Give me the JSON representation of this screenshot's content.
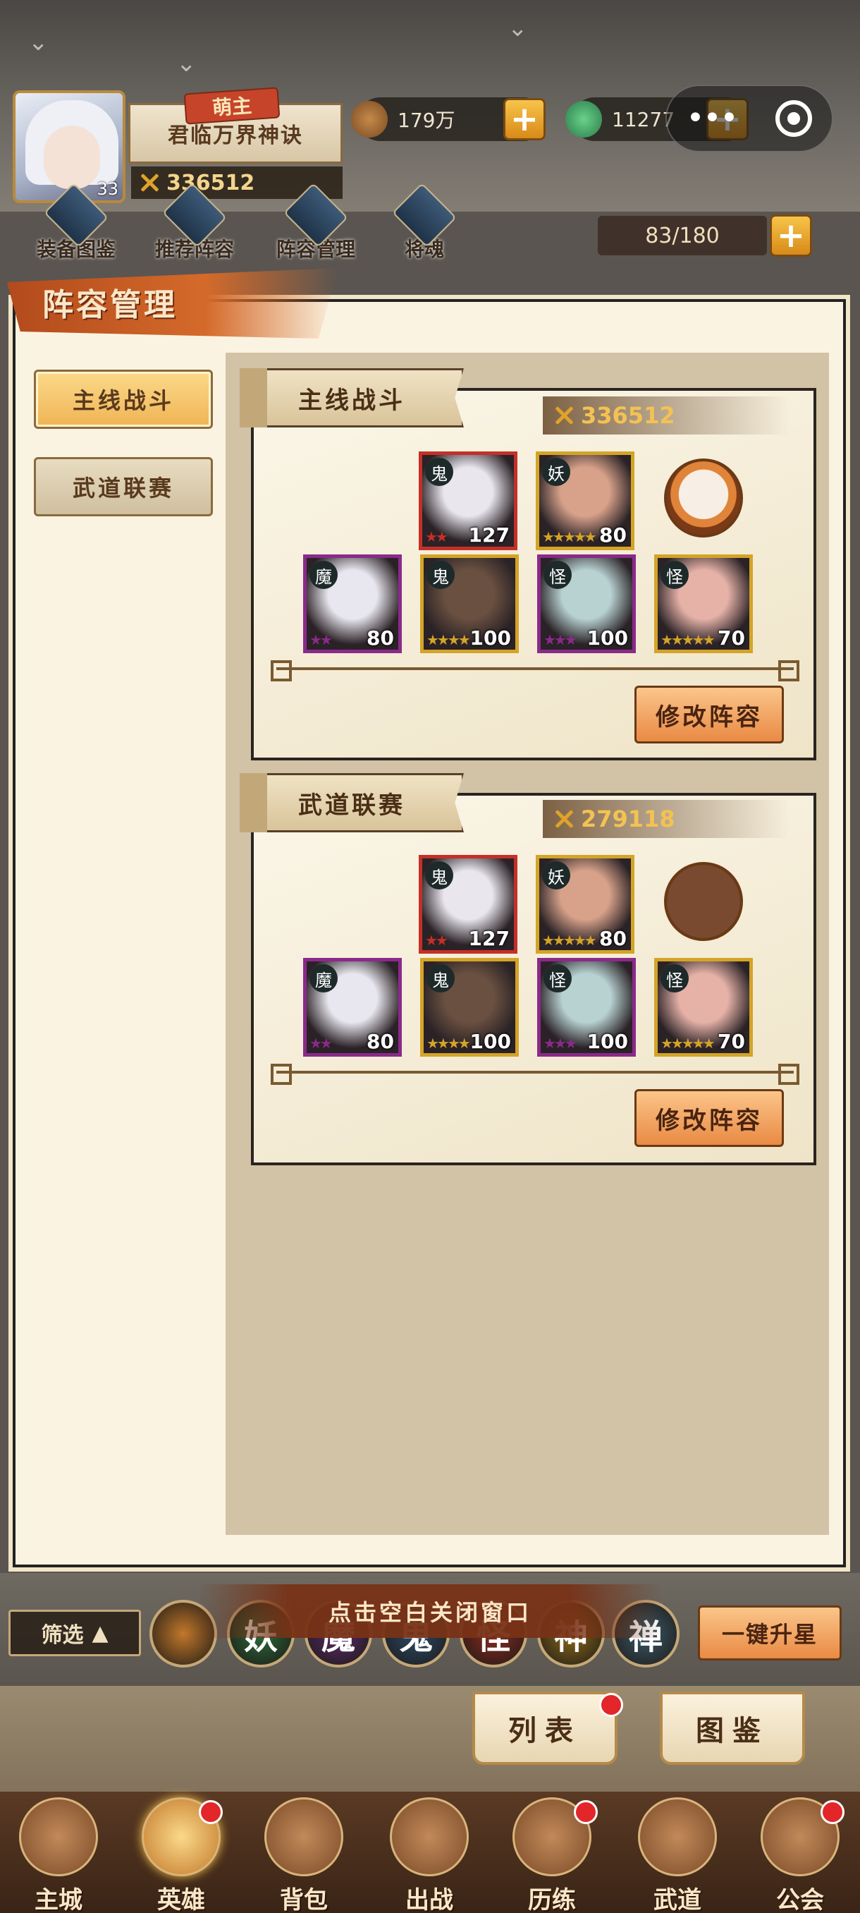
{
  "player": {
    "level": "33",
    "rank_badge": "萌主",
    "name": "君临万界神诀",
    "power": "336512"
  },
  "currencies": [
    {
      "name": "copper-coin",
      "value": "179万"
    },
    {
      "name": "jade",
      "value": "11277"
    }
  ],
  "shortcuts": [
    "装备图鉴",
    "推荐阵容",
    "阵容管理",
    "将魂"
  ],
  "hero_capacity": "83/180",
  "dialog": {
    "title": "阵容管理",
    "side_tabs": [
      {
        "label": "主线战斗",
        "active": true
      },
      {
        "label": "武道联赛",
        "active": false
      }
    ],
    "lineups": [
      {
        "label": "主线战斗",
        "power": "336512",
        "edit_label": "修改阵容",
        "pet_empty": false,
        "heroes": [
          {
            "faction": "鬼",
            "stars": "★★",
            "level": "127",
            "frame": "#c43028",
            "tone": "#e9e6ee"
          },
          {
            "faction": "妖",
            "stars": "★★★★★",
            "level": "80",
            "frame": "#d4a428",
            "tone": "#d8a28a"
          },
          {
            "faction": "魔",
            "stars": "★★",
            "level": "80",
            "frame": "#8a2a8a",
            "tone": "#e8e6ee"
          },
          {
            "faction": "鬼",
            "stars": "★★★★",
            "level": "100",
            "frame": "#d4a428",
            "tone": "#6a5040"
          },
          {
            "faction": "怪",
            "stars": "★★★",
            "level": "100",
            "frame": "#8a2a8a",
            "tone": "#b8d2d2"
          },
          {
            "faction": "怪",
            "stars": "★★★★★",
            "level": "70",
            "frame": "#d4a428",
            "tone": "#e6b2a8"
          }
        ]
      },
      {
        "label": "武道联赛",
        "power": "279118",
        "edit_label": "修改阵容",
        "pet_empty": true,
        "heroes": [
          {
            "faction": "鬼",
            "stars": "★★",
            "level": "127",
            "frame": "#c43028",
            "tone": "#e9e6ee"
          },
          {
            "faction": "妖",
            "stars": "★★★★★",
            "level": "80",
            "frame": "#d4a428",
            "tone": "#d8a28a"
          },
          {
            "faction": "魔",
            "stars": "★★",
            "level": "80",
            "frame": "#8a2a8a",
            "tone": "#e8e6ee"
          },
          {
            "faction": "鬼",
            "stars": "★★★★",
            "level": "100",
            "frame": "#d4a428",
            "tone": "#6a5040"
          },
          {
            "faction": "怪",
            "stars": "★★★",
            "level": "100",
            "frame": "#8a2a8a",
            "tone": "#b8d2d2"
          },
          {
            "faction": "怪",
            "stars": "★★★★★",
            "level": "70",
            "frame": "#d4a428",
            "tone": "#e6b2a8"
          }
        ]
      }
    ]
  },
  "filter": {
    "label": "筛选",
    "factions": [
      {
        "glyph": "",
        "color": "#c2782a"
      },
      {
        "glyph": "妖",
        "color": "#2a6a3a"
      },
      {
        "glyph": "魔",
        "color": "#5a2a6a"
      },
      {
        "glyph": "鬼",
        "color": "#2a4a6a"
      },
      {
        "glyph": "怪",
        "color": "#8a2a22"
      },
      {
        "glyph": "神",
        "color": "#8a6a1a"
      },
      {
        "glyph": "禅",
        "color": "#3a5a6a"
      }
    ],
    "close_hint": "点击空白关闭窗口",
    "upstar_label": "一键升星"
  },
  "tabs": [
    {
      "label": "列表",
      "badge": true
    },
    {
      "label": "图鉴",
      "badge": false
    }
  ],
  "nav": [
    {
      "label": "主城",
      "badge": false
    },
    {
      "label": "英雄",
      "badge": true,
      "active": true
    },
    {
      "label": "背包",
      "badge": false
    },
    {
      "label": "出战",
      "badge": false
    },
    {
      "label": "历练",
      "badge": true
    },
    {
      "label": "武道",
      "badge": false
    },
    {
      "label": "公会",
      "badge": true
    }
  ]
}
